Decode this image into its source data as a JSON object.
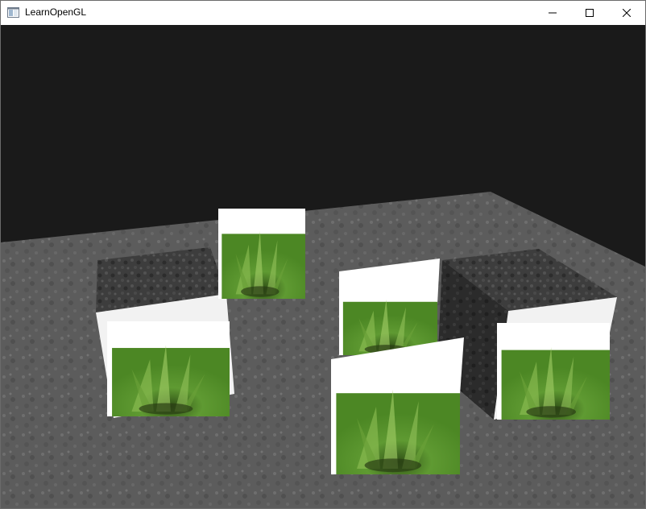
{
  "window": {
    "title": "LearnOpenGL",
    "icon": "app-window-icon",
    "controls": {
      "minimize_icon": "minimize-icon",
      "maximize_icon": "maximize-icon",
      "close_icon": "close-icon"
    }
  },
  "scene": {
    "clear_color": "#1a1a1a",
    "floor_color": "#5e5e5e",
    "cube_color": "#3c3c3c",
    "grass_color": "#4f8a2a",
    "objects": [
      "floor",
      "cube",
      "cube",
      "grass",
      "grass",
      "grass",
      "grass",
      "grass"
    ]
  }
}
